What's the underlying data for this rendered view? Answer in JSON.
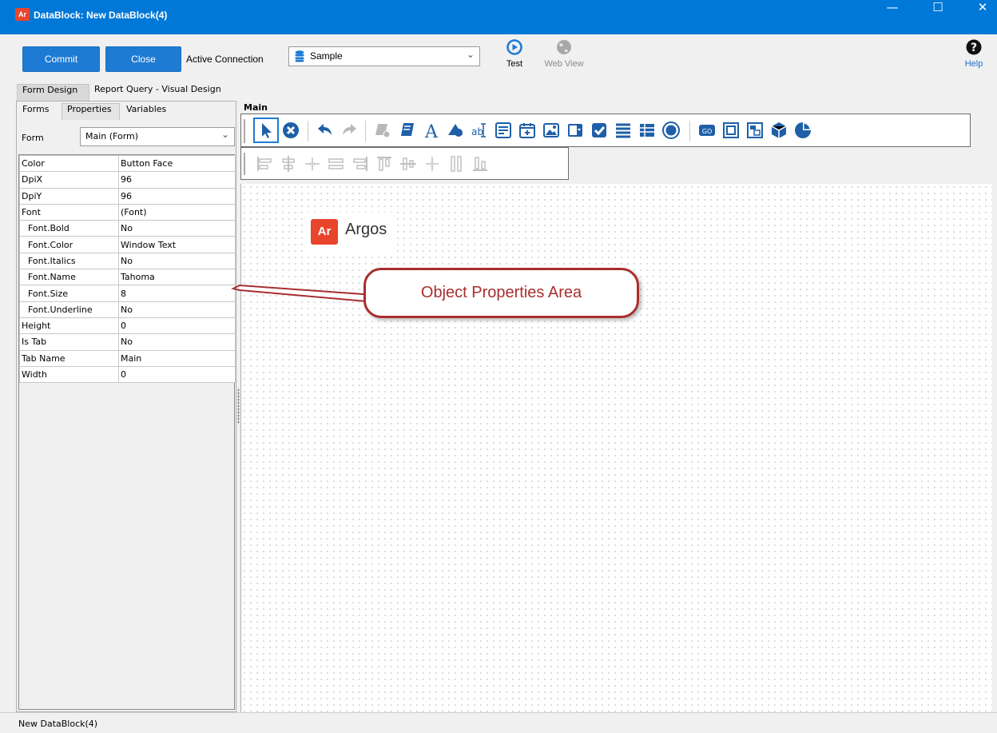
{
  "window": {
    "app_icon": "Ar",
    "title": "DataBlock: New DataBlock(4)",
    "controls": [
      "minimize-icon",
      "maximize-icon",
      "close-icon"
    ]
  },
  "toolbar": {
    "commit_label": "Commit",
    "close_label": "Close",
    "active_connection_label": "Active Connection",
    "connection_value": "Sample",
    "test_label": "Test",
    "webview_label": "Web View",
    "help_label": "Help"
  },
  "tabs": {
    "top": [
      "Form Design",
      "Report Query - Visual Design"
    ],
    "sub": [
      "Forms",
      "Properties",
      "Variables"
    ]
  },
  "form_selector": {
    "label": "Form",
    "value": "Main (Form)"
  },
  "properties": [
    {
      "key": "Color",
      "value": "Button Face",
      "indent": false
    },
    {
      "key": "DpiX",
      "value": "96",
      "indent": false
    },
    {
      "key": "DpiY",
      "value": "96",
      "indent": false
    },
    {
      "key": "Font",
      "value": "(Font)",
      "indent": false
    },
    {
      "key": "Font.Bold",
      "value": "No",
      "indent": true
    },
    {
      "key": "Font.Color",
      "value": "Window Text",
      "indent": true
    },
    {
      "key": "Font.Italics",
      "value": "No",
      "indent": true
    },
    {
      "key": "Font.Name",
      "value": "Tahoma",
      "indent": true
    },
    {
      "key": "Font.Size",
      "value": "8",
      "indent": true
    },
    {
      "key": "Font.Underline",
      "value": "No",
      "indent": true
    },
    {
      "key": "Height",
      "value": "0",
      "indent": false
    },
    {
      "key": "Is Tab",
      "value": "No",
      "indent": false
    },
    {
      "key": "Tab Name",
      "value": "Main",
      "indent": false
    },
    {
      "key": "Width",
      "value": "0",
      "indent": false
    }
  ],
  "designer": {
    "tab_label": "Main",
    "logo_mark": "Ar",
    "logo_text": "Argos"
  },
  "callout": {
    "text": "Object Properties Area"
  },
  "status": {
    "text": "New DataBlock(4)"
  },
  "colors": {
    "titlebar": "#0078d7",
    "button": "#1e7bd4",
    "brand": "#e8452c",
    "callout": "#a92e2e"
  }
}
